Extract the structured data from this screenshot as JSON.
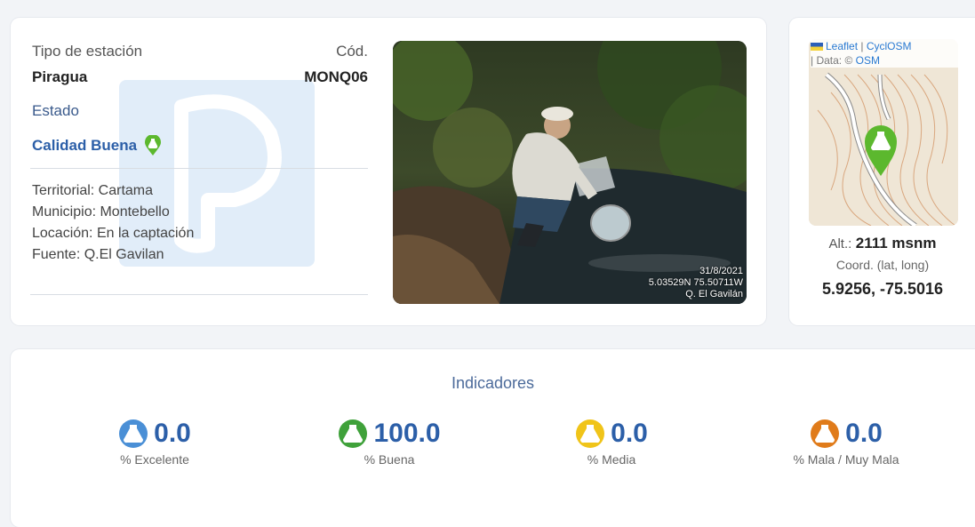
{
  "station": {
    "tipo_label": "Tipo de estación",
    "tipo_value": "Piragua",
    "cod_label": "Cód.",
    "cod_value": "MONQ06",
    "estado_label": "Estado",
    "calidad_value": "Calidad Buena",
    "territorial": "Territorial: Cartama",
    "municipio": "Municipio: Montebello",
    "locacion": "Locación: En la captación",
    "fuente": "Fuente: Q.El Gavilan"
  },
  "photo": {
    "stamp_date": "31/8/2021",
    "stamp_coords": "5.03529N 75.50711W",
    "stamp_place": "Q. El Gavilán"
  },
  "map": {
    "attrib_leaflet": "Leaflet",
    "attrib_sep": " | ",
    "attrib_cyclosm": "CyclOSM",
    "attrib_data": "| Data: © ",
    "attrib_osm": "OSM",
    "alt_label": "Alt.:",
    "alt_value": "2111 msnm",
    "coord_label": "Coord. (lat, long)",
    "coord_value": "5.9256, -75.5016"
  },
  "indicators": {
    "title": "Indicadores",
    "items": [
      {
        "value": "0.0",
        "label": "% Excelente",
        "color": "#4a8fd6"
      },
      {
        "value": "100.0",
        "label": "% Buena",
        "color": "#3fa13a"
      },
      {
        "value": "0.0",
        "label": "% Media",
        "color": "#f0c419"
      },
      {
        "value": "0.0",
        "label": "% Mala / Muy Mala",
        "color": "#e07b1a"
      }
    ]
  },
  "colors": {
    "accent_blue": "#2c5fa8",
    "marker_green": "#5cb82e"
  }
}
